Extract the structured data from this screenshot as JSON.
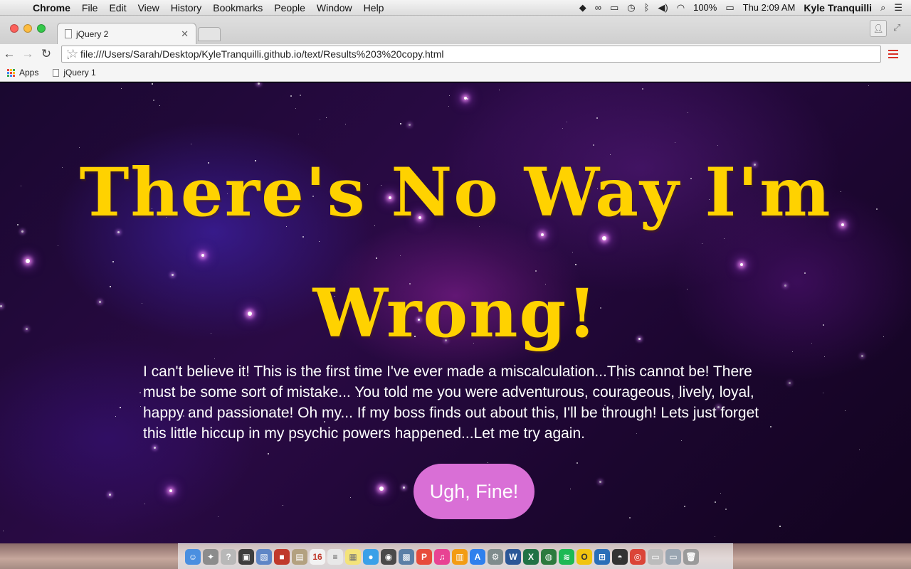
{
  "menubar": {
    "apple_icon": "apple-logo-icon",
    "app_name": "Chrome",
    "items": [
      "File",
      "Edit",
      "View",
      "History",
      "Bookmarks",
      "People",
      "Window",
      "Help"
    ],
    "battery": "100%",
    "clock": "Thu 2:09 AM",
    "user": "Kyle Tranquilli"
  },
  "browser": {
    "tab_title": "jQuery 2",
    "url": "file:///Users/Sarah/Desktop/KyleTranquilli.github.io/text/Results%203%20copy.html",
    "bookmarks": [
      "Apps",
      "jQuery 1"
    ]
  },
  "page": {
    "headline": "There's No Way I'm Wrong!",
    "body": "I can't believe it! This is the first time I've ever made a miscalculation...This cannot be! There must be some sort of mistake... You told me you were adventurous, courageous, lively, loyal, happy and passionate! Oh my... If my boss finds out about this, I'll be through! Lets just forget this little hiccup in my psychic powers happened...Let me try again.",
    "button_label": "Ugh, Fine!",
    "colors": {
      "headline": "#ffd200",
      "button": "#d96fd6",
      "body_text": "#ffffff"
    }
  }
}
